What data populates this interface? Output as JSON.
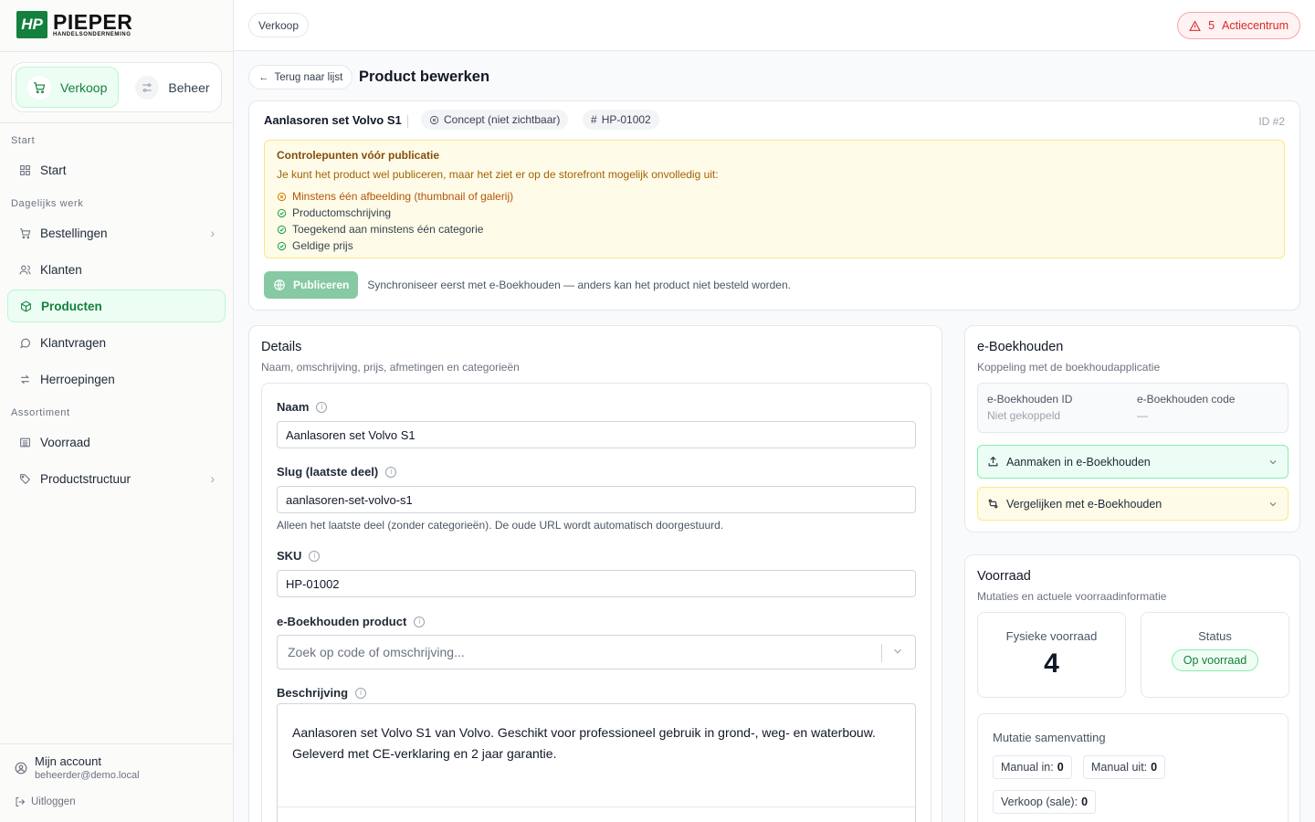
{
  "brand": {
    "mark": "HP",
    "name": "PIEPER",
    "sub": "HANDELSONDERNEMING"
  },
  "modes": [
    {
      "label": "Verkoop",
      "active": true
    },
    {
      "label": "Beheer",
      "active": false
    }
  ],
  "nav": {
    "groups": {
      "start": "Start",
      "daily": "Dagelijks werk",
      "assortment": "Assortiment"
    },
    "items": {
      "start": "Start",
      "orders": "Bestellingen",
      "customers": "Klanten",
      "products": "Producten",
      "questions": "Klantvragen",
      "returns": "Herroepingen",
      "stock": "Voorraad",
      "structure": "Productstructuur"
    }
  },
  "account": {
    "name": "Mijn account",
    "email": "beheerder@demo.local",
    "logout": "Uitloggen"
  },
  "topbar": {
    "breadcrumb": "Verkoop",
    "action_count": "5",
    "action_label": "Actiecentrum"
  },
  "page": {
    "back": "Terug naar lijst",
    "title": "Product bewerken"
  },
  "product": {
    "name": "Aanlasoren set Volvo S1",
    "status": "Concept (niet zichtbaar)",
    "sku_chip": "HP-01002",
    "id": "ID #2"
  },
  "checks": {
    "title": "Controlepunten vóór publicatie",
    "text": "Je kunt het product wel publiceren, maar het ziet er op de storefront mogelijk onvolledig uit:",
    "items": [
      {
        "label": "Minstens één afbeelding (thumbnail of galerij)",
        "ok": false
      },
      {
        "label": "Productomschrijving",
        "ok": true
      },
      {
        "label": "Toegekend aan minstens één categorie",
        "ok": true
      },
      {
        "label": "Geldige prijs",
        "ok": true
      }
    ]
  },
  "publish": {
    "button": "Publiceren",
    "note": "Synchroniseer eerst met e-Boekhouden — anders kan het product niet besteld worden."
  },
  "details": {
    "title": "Details",
    "subtitle": "Naam, omschrijving, prijs, afmetingen en categorieën",
    "name_label": "Naam",
    "name_value": "Aanlasoren set Volvo S1",
    "slug_label": "Slug (laatste deel)",
    "slug_value": "aanlasoren-set-volvo-s1",
    "slug_help": "Alleen het laatste deel (zonder categorieën). De oude URL wordt automatisch doorgestuurd.",
    "sku_label": "SKU",
    "sku_value": "HP-01002",
    "eb_label": "e-Boekhouden product",
    "eb_placeholder": "Zoek op code of omschrijving...",
    "desc_label": "Beschrijving",
    "desc_line1": "Aanlasoren set Volvo S1 van Volvo. Geschikt voor professioneel gebruik in grond-, weg- en waterbouw.",
    "desc_line2": "Geleverd met CE-verklaring en 2 jaar garantie."
  },
  "eboekhouden": {
    "title": "e-Boekhouden",
    "subtitle": "Koppeling met de boekhoudapplicatie",
    "id_label": "e-Boekhouden ID",
    "id_value": "Niet gekoppeld",
    "code_label": "e-Boekhouden code",
    "code_value": "—",
    "create": "Aanmaken in e-Boekhouden",
    "compare": "Vergelijken met e-Boekhouden"
  },
  "stock": {
    "title": "Voorraad",
    "subtitle": "Mutaties en actuele voorraadinformatie",
    "physical_label": "Fysieke voorraad",
    "physical_value": "4",
    "status_label": "Status",
    "status_value": "Op voorraad",
    "summary_title": "Mutatie samenvatting",
    "manual_in_label": "Manual in:",
    "manual_in_value": "0",
    "manual_out_label": "Manual uit:",
    "manual_out_value": "0",
    "sale_label": "Verkoop (sale):",
    "sale_value": "0"
  },
  "colors": {
    "brand_green": "#15803d",
    "warning_bg": "#fefce8",
    "danger": "#dc2626"
  }
}
